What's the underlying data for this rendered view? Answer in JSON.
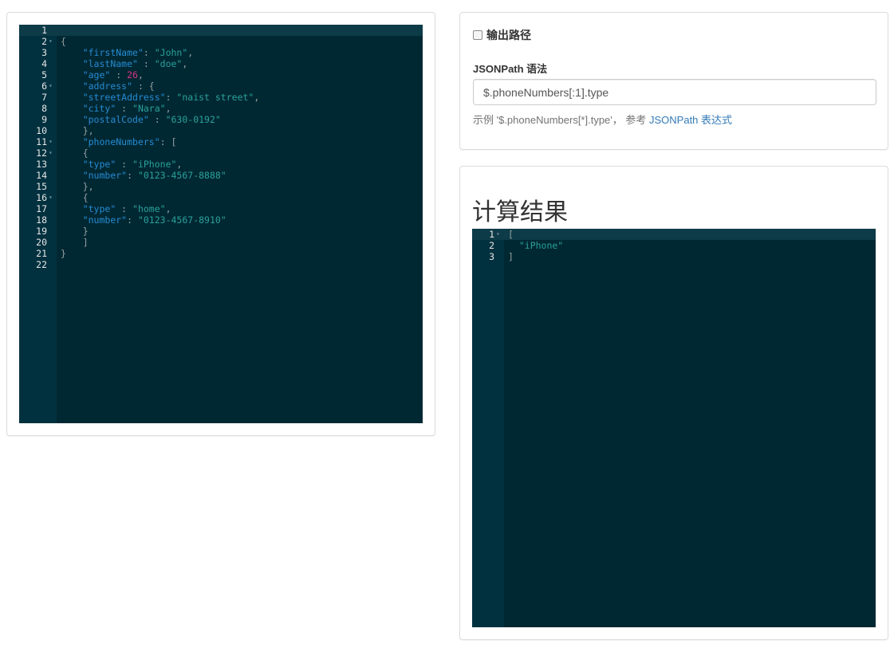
{
  "json_editor": {
    "lines": [
      {
        "n": "1",
        "fold": "",
        "active": true,
        "tokens": []
      },
      {
        "n": "2",
        "fold": "▾",
        "tokens": [
          {
            "t": "p",
            "v": "{"
          }
        ]
      },
      {
        "n": "3",
        "fold": "",
        "tokens": [
          {
            "t": "p",
            "v": "    "
          },
          {
            "t": "k",
            "v": "\"firstName\""
          },
          {
            "t": "p",
            "v": ": "
          },
          {
            "t": "s",
            "v": "\"John\""
          },
          {
            "t": "p",
            "v": ","
          }
        ]
      },
      {
        "n": "4",
        "fold": "",
        "tokens": [
          {
            "t": "p",
            "v": "    "
          },
          {
            "t": "k",
            "v": "\"lastName\""
          },
          {
            "t": "p",
            "v": " : "
          },
          {
            "t": "s",
            "v": "\"doe\""
          },
          {
            "t": "p",
            "v": ","
          }
        ]
      },
      {
        "n": "5",
        "fold": "",
        "tokens": [
          {
            "t": "p",
            "v": "    "
          },
          {
            "t": "k",
            "v": "\"age\""
          },
          {
            "t": "p",
            "v": " : "
          },
          {
            "t": "n",
            "v": "26"
          },
          {
            "t": "p",
            "v": ","
          }
        ]
      },
      {
        "n": "6",
        "fold": "▾",
        "tokens": [
          {
            "t": "p",
            "v": "    "
          },
          {
            "t": "k",
            "v": "\"address\""
          },
          {
            "t": "p",
            "v": " : {"
          }
        ]
      },
      {
        "n": "7",
        "fold": "",
        "tokens": [
          {
            "t": "p",
            "v": "    "
          },
          {
            "t": "k",
            "v": "\"streetAddress\""
          },
          {
            "t": "p",
            "v": ": "
          },
          {
            "t": "s",
            "v": "\"naist street\""
          },
          {
            "t": "p",
            "v": ","
          }
        ]
      },
      {
        "n": "8",
        "fold": "",
        "tokens": [
          {
            "t": "p",
            "v": "    "
          },
          {
            "t": "k",
            "v": "\"city\""
          },
          {
            "t": "p",
            "v": " : "
          },
          {
            "t": "s",
            "v": "\"Nara\""
          },
          {
            "t": "p",
            "v": ","
          }
        ]
      },
      {
        "n": "9",
        "fold": "",
        "tokens": [
          {
            "t": "p",
            "v": "    "
          },
          {
            "t": "k",
            "v": "\"postalCode\""
          },
          {
            "t": "p",
            "v": " : "
          },
          {
            "t": "s",
            "v": "\"630-0192\""
          }
        ]
      },
      {
        "n": "10",
        "fold": "",
        "tokens": [
          {
            "t": "p",
            "v": "    },"
          }
        ]
      },
      {
        "n": "11",
        "fold": "▾",
        "tokens": [
          {
            "t": "p",
            "v": "    "
          },
          {
            "t": "k",
            "v": "\"phoneNumbers\""
          },
          {
            "t": "p",
            "v": ": ["
          }
        ]
      },
      {
        "n": "12",
        "fold": "▾",
        "tokens": [
          {
            "t": "p",
            "v": "    {"
          }
        ]
      },
      {
        "n": "13",
        "fold": "",
        "tokens": [
          {
            "t": "p",
            "v": "    "
          },
          {
            "t": "k",
            "v": "\"type\""
          },
          {
            "t": "p",
            "v": " : "
          },
          {
            "t": "s",
            "v": "\"iPhone\""
          },
          {
            "t": "p",
            "v": ","
          }
        ]
      },
      {
        "n": "14",
        "fold": "",
        "tokens": [
          {
            "t": "p",
            "v": "    "
          },
          {
            "t": "k",
            "v": "\"number\""
          },
          {
            "t": "p",
            "v": ": "
          },
          {
            "t": "s",
            "v": "\"0123-4567-8888\""
          }
        ]
      },
      {
        "n": "15",
        "fold": "",
        "tokens": [
          {
            "t": "p",
            "v": "    },"
          }
        ]
      },
      {
        "n": "16",
        "fold": "▾",
        "tokens": [
          {
            "t": "p",
            "v": "    {"
          }
        ]
      },
      {
        "n": "17",
        "fold": "",
        "tokens": [
          {
            "t": "p",
            "v": "    "
          },
          {
            "t": "k",
            "v": "\"type\""
          },
          {
            "t": "p",
            "v": " : "
          },
          {
            "t": "s",
            "v": "\"home\""
          },
          {
            "t": "p",
            "v": ","
          }
        ]
      },
      {
        "n": "18",
        "fold": "",
        "tokens": [
          {
            "t": "p",
            "v": "    "
          },
          {
            "t": "k",
            "v": "\"number\""
          },
          {
            "t": "p",
            "v": ": "
          },
          {
            "t": "s",
            "v": "\"0123-4567-8910\""
          }
        ]
      },
      {
        "n": "19",
        "fold": "",
        "tokens": [
          {
            "t": "p",
            "v": "    }"
          }
        ]
      },
      {
        "n": "20",
        "fold": "",
        "tokens": [
          {
            "t": "p",
            "v": "    ]"
          }
        ]
      },
      {
        "n": "21",
        "fold": "",
        "tokens": [
          {
            "t": "p",
            "v": "}"
          }
        ]
      },
      {
        "n": "22",
        "fold": "",
        "tokens": []
      }
    ]
  },
  "options": {
    "output_path_label": "输出路径",
    "output_path_checked": false,
    "syntax_label": "JSONPath 语法",
    "jsonpath_value": "$.phoneNumbers[:1].type",
    "help_prefix": "示例 '$.phoneNumbers[*].type'，  参考 ",
    "help_link": "JSONPath 表达式"
  },
  "result": {
    "title": "计算结果",
    "lines": [
      {
        "n": "1",
        "fold": "▾",
        "active": true,
        "tokens": [
          {
            "t": "p",
            "v": "["
          }
        ]
      },
      {
        "n": "2",
        "fold": "",
        "tokens": [
          {
            "t": "p",
            "v": "  "
          },
          {
            "t": "s",
            "v": "\"iPhone\""
          }
        ]
      },
      {
        "n": "3",
        "fold": "",
        "tokens": [
          {
            "t": "p",
            "v": "]"
          }
        ]
      }
    ]
  },
  "colors": {
    "editor_bg": "#002833",
    "gutter_bg": "#01313f",
    "key": "#268bd2",
    "string": "#2aa198",
    "number": "#d33682",
    "link": "#337ab7"
  }
}
